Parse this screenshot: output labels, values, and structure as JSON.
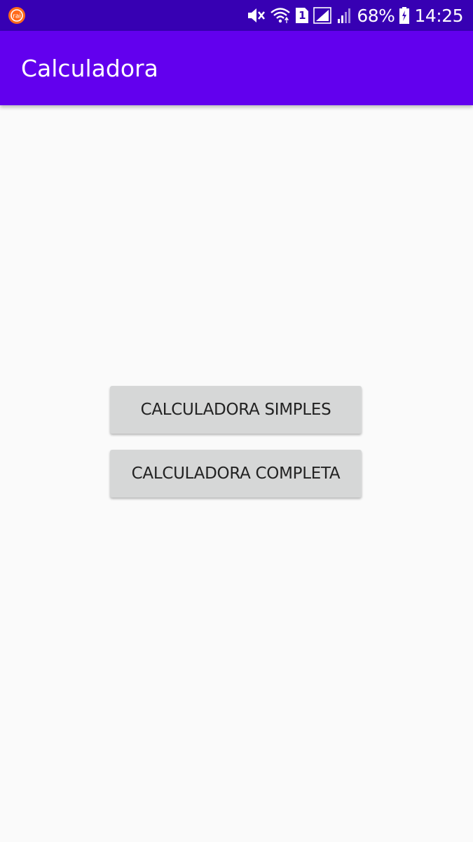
{
  "status_bar": {
    "battery_percent": "68%",
    "time": "14:25",
    "sim_slot": "1",
    "icons": [
      "app-notification-icon",
      "mute-icon",
      "wifi-icon",
      "sim-icon",
      "signal-icon",
      "signal-weak-icon",
      "battery-charging-icon"
    ]
  },
  "app_bar": {
    "title": "Calculadora"
  },
  "main": {
    "buttons": [
      {
        "label": "CALCULADORA SIMPLES"
      },
      {
        "label": "CALCULADORA COMPLETA"
      }
    ]
  },
  "colors": {
    "status_bar": "#3700b3",
    "app_bar": "#6200ee",
    "background": "#fafafa",
    "button": "#d6d7d7",
    "button_text": "#222222"
  }
}
